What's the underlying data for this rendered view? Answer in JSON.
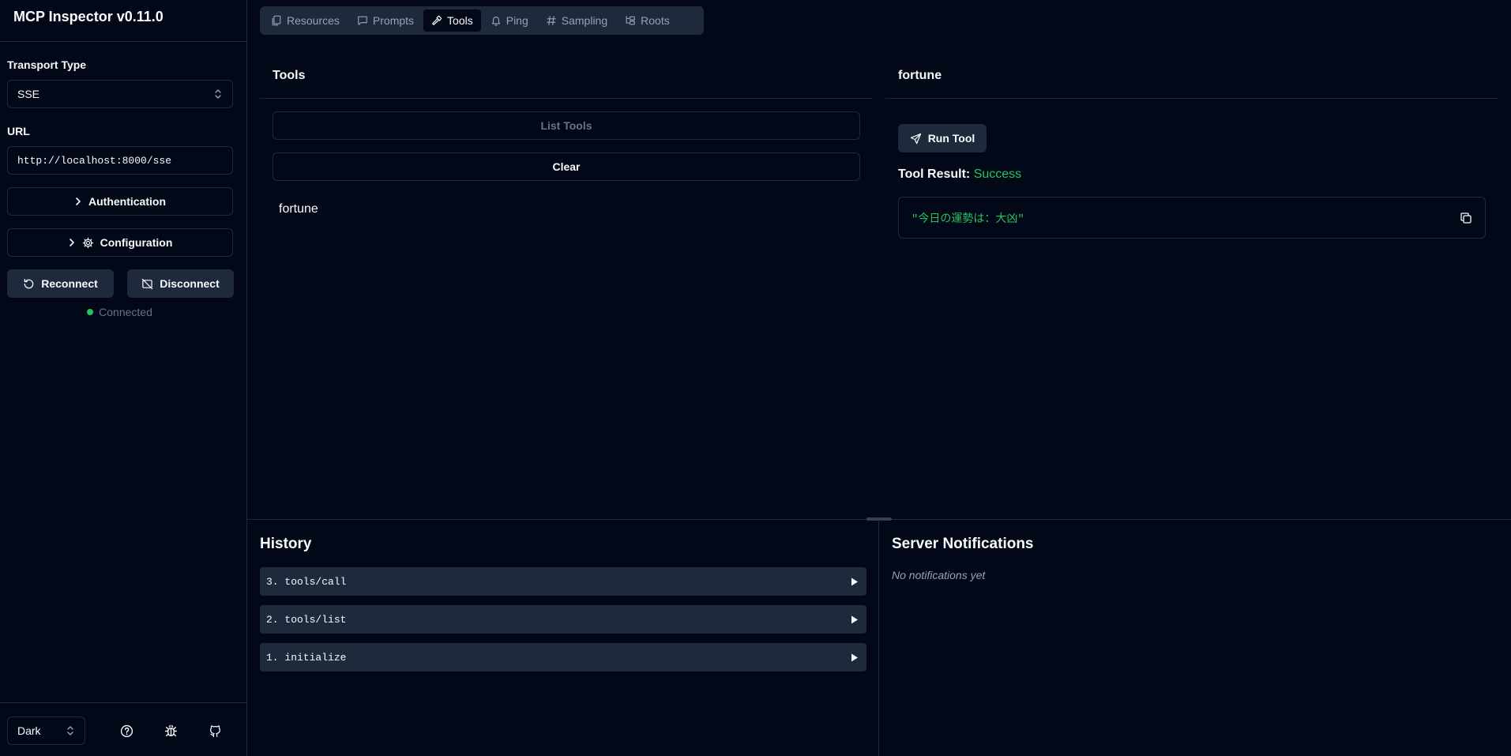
{
  "app": {
    "title": "MCP Inspector v0.11.0"
  },
  "sidebar": {
    "transport_label": "Transport Type",
    "transport_value": "SSE",
    "url_label": "URL",
    "url_value": "http://localhost:8000/sse",
    "authentication_label": "Authentication",
    "configuration_label": "Configuration",
    "reconnect_label": "Reconnect",
    "disconnect_label": "Disconnect",
    "status_text": "Connected",
    "theme_value": "Dark"
  },
  "tabs": [
    {
      "label": "Resources",
      "icon": "files-icon"
    },
    {
      "label": "Prompts",
      "icon": "message-icon"
    },
    {
      "label": "Tools",
      "icon": "hammer-icon",
      "active": true
    },
    {
      "label": "Ping",
      "icon": "bell-icon"
    },
    {
      "label": "Sampling",
      "icon": "hash-icon"
    },
    {
      "label": "Roots",
      "icon": "folder-tree-icon"
    }
  ],
  "tools_panel": {
    "title": "Tools",
    "list_tools_label": "List Tools",
    "clear_label": "Clear",
    "items": [
      "fortune"
    ]
  },
  "tool_detail": {
    "title": "fortune",
    "run_label": "Run Tool",
    "result_label": "Tool Result:",
    "result_status": "Success",
    "result_text": "\"今日の運勢は：大凶\""
  },
  "history": {
    "title": "History",
    "items": [
      "3. tools/call",
      "2. tools/list",
      "1. initialize"
    ]
  },
  "notifications": {
    "title": "Server Notifications",
    "empty_text": "No notifications yet"
  },
  "colors": {
    "background": "#020817",
    "surface": "#1e293b",
    "border": "#1e293b",
    "success": "#22c55e",
    "muted": "#64748b"
  }
}
